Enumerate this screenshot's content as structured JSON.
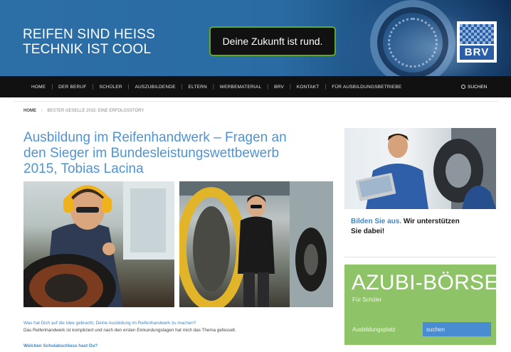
{
  "header": {
    "slogan_line1": "REIFEN SIND HEISS",
    "slogan_line2": "TECHNIK IST COOL",
    "tagline": "Deine Zukunft ist rund.",
    "logo_text": "BRV"
  },
  "nav": {
    "items": [
      "HOME",
      "DER BERUF",
      "SCHÜLER",
      "AUSZUBILDENDE",
      "ELTERN",
      "WERBEMATERIAL",
      "BRV",
      "KONTAKT",
      "FÜR AUSBILDUNGSBETRIEBE"
    ],
    "search_label": "SUCHEN"
  },
  "breadcrumb": {
    "home": "HOME",
    "current": "BESTER GESELLE 2015: EINE ERFOLGSSTORY"
  },
  "article": {
    "title_line1": "Ausbildung im Reifenhandwerk – Fragen an",
    "title_line2": "den Sieger im Bundesleistungswettbewerb",
    "title_line3": "2015, Tobias Lacina",
    "question1": "Was hat Dich auf die Idee gebracht, Deine Ausbildung im Reifenhandwerk zu machen?",
    "answer1": "Das Reifenhandwerk ist kompliziert und nach den ersten Einkundungstagen hat mich das Thema gefesselt.",
    "question2": "Welchen Schulabschluss hast Du?"
  },
  "sidebar": {
    "bilden_blue": "Bilden Sie aus.",
    "bilden_black": " Wir unterstützen",
    "bilden_line2": "Sie dabei!",
    "azubi_title": "AZUBI-BÖRSE",
    "azubi_sub": "Für Schüler",
    "azubi_label": "Ausbildungsplatz",
    "azubi_placeholder": "suchen"
  },
  "colors": {
    "header_blue": "#2c6ea6",
    "nav_black": "#111111",
    "title_blue": "#4f93d3",
    "azubi_green": "#8ec367",
    "search_blue": "#4a8cd1",
    "badge_border_green": "#5fa82a"
  },
  "icons": {
    "search": "magnifier-icon"
  }
}
